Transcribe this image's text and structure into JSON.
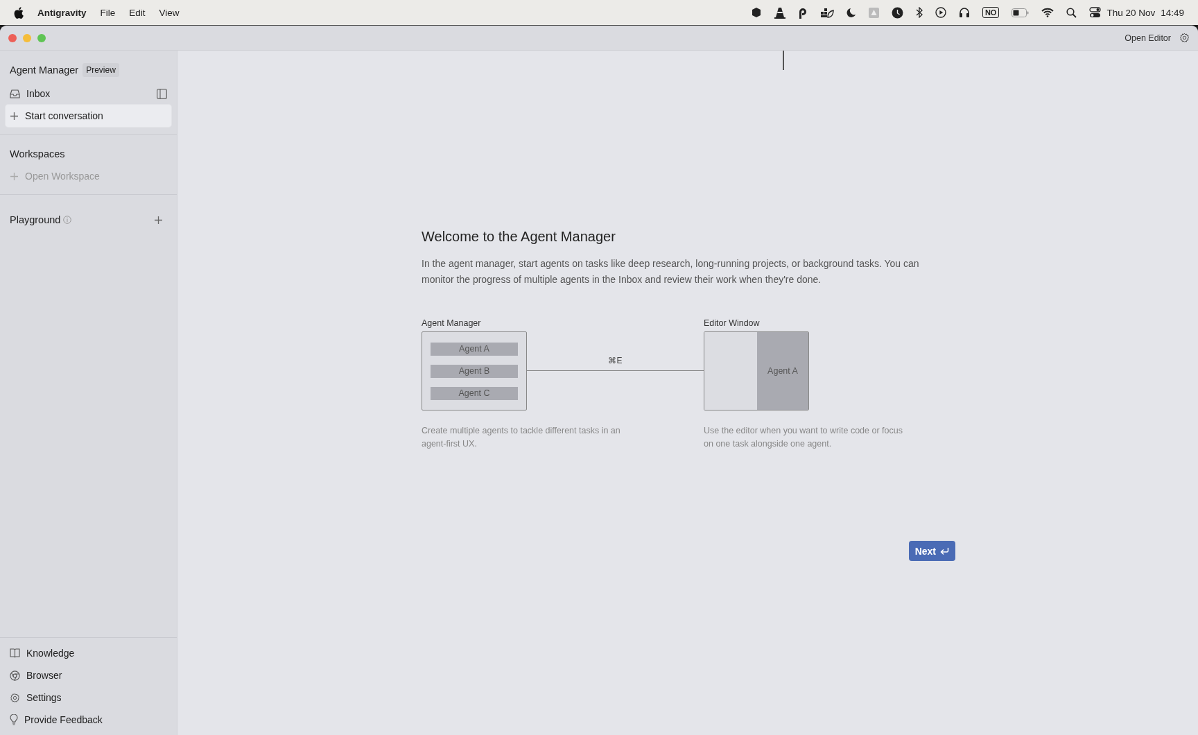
{
  "menu_bar": {
    "app_name": "Antigravity",
    "menus": [
      "File",
      "Edit",
      "View"
    ],
    "status_badge": "NO",
    "date": "Thu 20 Nov",
    "time": "14:49"
  },
  "window": {
    "open_editor": "Open Editor"
  },
  "sidebar": {
    "title": "Agent Manager",
    "badge": "Preview",
    "top_items": [
      {
        "kind": "inbox",
        "label": "Inbox",
        "selected": false
      },
      {
        "kind": "new",
        "label": "Start conversation",
        "selected": true
      }
    ],
    "workspaces": {
      "heading": "Workspaces",
      "items": [
        {
          "label": "Open Workspace",
          "disabled": true
        }
      ]
    },
    "playground": {
      "heading": "Playground"
    },
    "footer_items": [
      {
        "kind": "book",
        "label": "Knowledge"
      },
      {
        "kind": "browser",
        "label": "Browser"
      },
      {
        "kind": "gear",
        "label": "Settings"
      },
      {
        "kind": "bulb",
        "label": "Provide Feedback"
      }
    ]
  },
  "welcome": {
    "title": "Welcome to the Agent Manager",
    "body": "In the agent manager, start agents on tasks like deep research, long-running projects, or background tasks. You can monitor the progress of multiple agents in the Inbox and review their work when they're done.",
    "diagram": {
      "left_label": "Agent Manager",
      "agents": [
        "Agent A",
        "Agent B",
        "Agent C"
      ],
      "shortcut": "⌘E",
      "right_label": "Editor Window",
      "editor_agent": "Agent A",
      "left_caption": "Create multiple agents to tackle different tasks in an agent-first UX.",
      "right_caption": "Use the editor when you want to write code or focus on one task alongside one agent."
    },
    "next_button": "Next"
  }
}
